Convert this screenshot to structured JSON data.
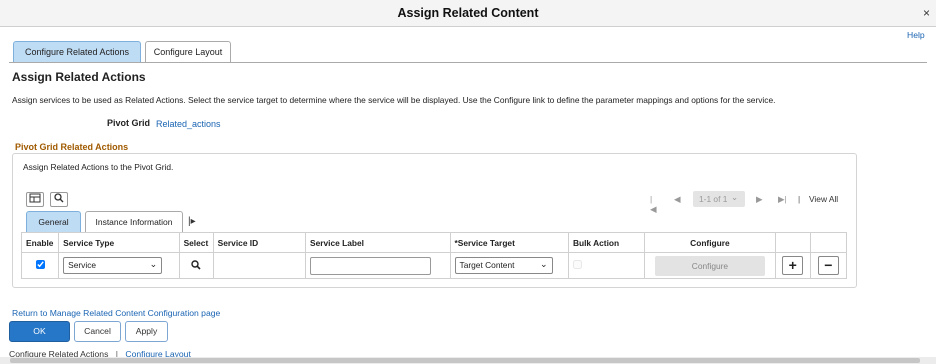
{
  "window": {
    "title": "Assign Related Content",
    "close": "×"
  },
  "help": "Help",
  "tabs": [
    {
      "label": "Configure Related Actions"
    },
    {
      "label": "Configure Layout"
    }
  ],
  "page": {
    "heading": "Assign Related Actions",
    "description": "Assign services to be used as Related Actions. Select the service target to determine where the service will be displayed. Use the Configure link to define the parameter mappings and options for the service.",
    "pivot_grid_label": "Pivot Grid",
    "pivot_grid_value": "Related_actions"
  },
  "section": {
    "title": "Pivot Grid Related Actions",
    "subtitle": "Assign Related Actions to the Pivot Grid.",
    "pager": {
      "first": "|◀",
      "prev": "◀",
      "range": "1-1 of 1",
      "range_caret": "⌄",
      "next": "▶",
      "last": "▶|",
      "sep": "|",
      "view_all": "View All"
    },
    "grid_tabs": [
      {
        "label": "General"
      },
      {
        "label": "Instance Information"
      }
    ],
    "columns": {
      "enable": "Enable",
      "service_type": "Service Type",
      "select": "Select",
      "service_id": "Service ID",
      "service_label": "Service Label",
      "service_target": "*Service Target",
      "bulk_action": "Bulk Action",
      "configure": "Configure"
    },
    "row": {
      "enabled": true,
      "service_type": "Service",
      "service_id": "",
      "service_label": "",
      "service_target": "Target Content",
      "bulk_action": false,
      "configure_label": "Configure",
      "add": "+",
      "remove": "−"
    }
  },
  "footer": {
    "return_link": "Return to Manage Related Content Configuration page",
    "ok": "OK",
    "cancel": "Cancel",
    "apply": "Apply",
    "links": [
      "Configure Related Actions",
      "Configure Layout"
    ],
    "link_sep": "|"
  },
  "colors": {
    "accent": "#2777c8",
    "tab_active": "#bfdcf5",
    "link": "#1a64b3",
    "section_title": "#a05a00"
  }
}
